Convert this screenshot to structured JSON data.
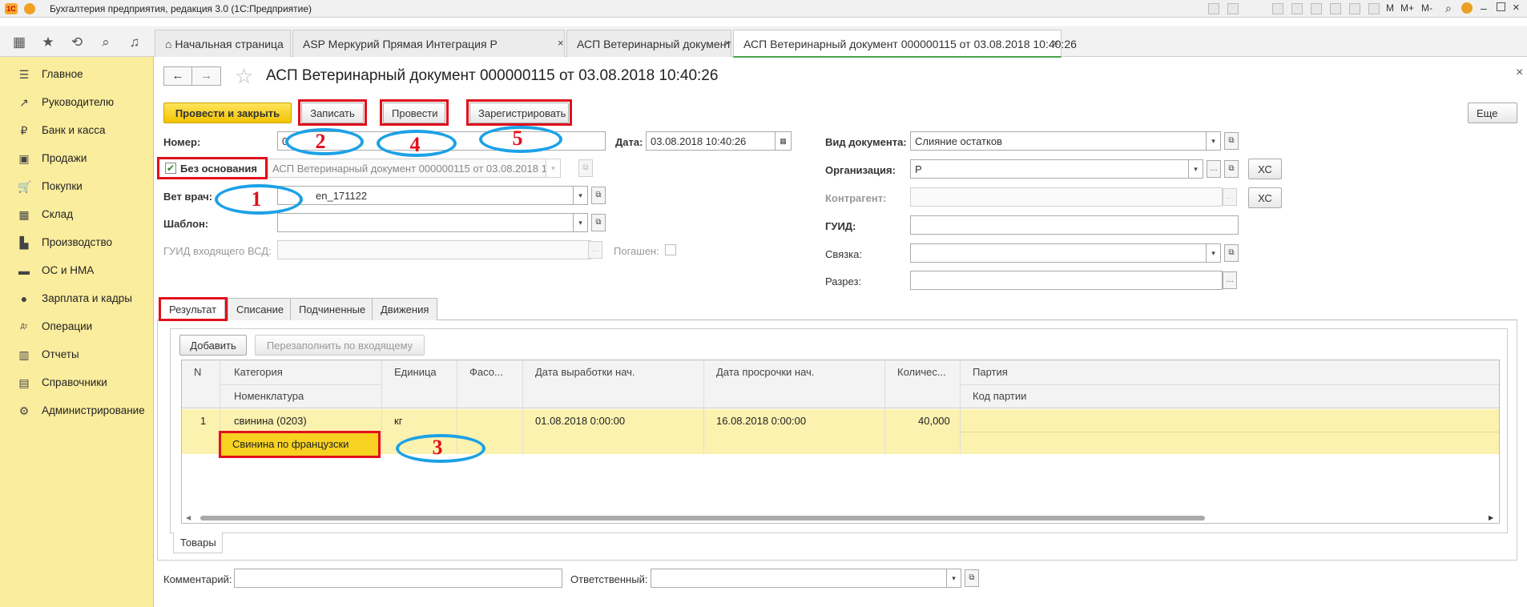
{
  "window": {
    "title": "Бухгалтерия предприятия, редакция 3.0  (1С:Предприятие)",
    "right_tools": [
      "M",
      "M+",
      "M-"
    ]
  },
  "tabs": [
    {
      "label": "Начальная страница",
      "closable": false
    },
    {
      "label": "ASP Меркурий Прямая Интеграция Р",
      "closable": true
    },
    {
      "label": "АСП Ветеринарный документ",
      "closable": true
    },
    {
      "label": "АСП Ветеринарный документ 000000115 от 03.08.2018 10:40:26",
      "closable": true
    }
  ],
  "close_glyph": "×",
  "sidebar": {
    "items": [
      {
        "label": "Главное",
        "icon": "menu-icon",
        "glyph": "☰"
      },
      {
        "label": "Руководителю",
        "icon": "trend-icon",
        "glyph": "↗"
      },
      {
        "label": "Банк и касса",
        "icon": "coin-icon",
        "glyph": "₽"
      },
      {
        "label": "Продажи",
        "icon": "bag-icon",
        "glyph": "▣"
      },
      {
        "label": "Покупки",
        "icon": "cart-icon",
        "glyph": "🛒"
      },
      {
        "label": "Склад",
        "icon": "grid-icon",
        "glyph": "▦"
      },
      {
        "label": "Производство",
        "icon": "factory-icon",
        "glyph": "▙"
      },
      {
        "label": "ОС и НМА",
        "icon": "truck-icon",
        "glyph": "▬"
      },
      {
        "label": "Зарплата и кадры",
        "icon": "person-icon",
        "glyph": "●"
      },
      {
        "label": "Операции",
        "icon": "operations-icon",
        "glyph": "Дт"
      },
      {
        "label": "Отчеты",
        "icon": "chart-icon",
        "glyph": "▥"
      },
      {
        "label": "Справочники",
        "icon": "book-icon",
        "glyph": "▤"
      },
      {
        "label": "Администрирование",
        "icon": "gear-icon",
        "glyph": "⚙"
      }
    ]
  },
  "doc": {
    "title": "АСП Ветеринарный документ 000000115 от 03.08.2018 10:40:26",
    "buttons": {
      "post_close": "Провести и закрыть",
      "save": "Записать",
      "post": "Провести",
      "register": "Зарегистрировать",
      "more": "Еще"
    },
    "fields": {
      "number_label": "Номер:",
      "number_value": "0",
      "date_label": "Дата:",
      "date_value": "03.08.2018 10:40:26",
      "no_basis_label": "Без основания",
      "basis_value": "АСП Ветеринарный документ 000000115 от 03.08.2018 10",
      "vet_label": "Вет врач:",
      "vet_value": "en_171122",
      "template_label": "Шаблон:",
      "template_value": "",
      "guid_in_label": "ГУИД входящего ВСД:",
      "guid_in_value": "",
      "paid_label": "Погашен:",
      "doctype_label": "Вид документа:",
      "doctype_value": "Слияние остатков",
      "org_label": "Организация:",
      "org_value": "Р",
      "contractor_label": "Контрагент:",
      "contractor_value": "",
      "guid_label": "ГУИД:",
      "guid_value": "",
      "link_label": "Связка:",
      "link_value": "",
      "section_label": "Разрез:",
      "section_value": "",
      "xc": "ХС"
    },
    "subtabs": [
      "Результат",
      "Списание",
      "Подчиненные",
      "Движения"
    ],
    "table_buttons": {
      "add": "Добавить",
      "refill": "Перезаполнить по входящему"
    },
    "table": {
      "headers_top": [
        "N",
        "Категория",
        "Единица",
        "Фасо...",
        "Дата выработки нач.",
        "Дата просрочки нач.",
        "Количес...",
        "Партия"
      ],
      "headers_bottom": [
        "Номенклатура",
        "Код партии"
      ],
      "rows": [
        {
          "n": "1",
          "category": "свинина (0203)",
          "nomenclature": "Свинина по французски",
          "unit": "кг",
          "packing": "",
          "prod_date": "01.08.2018 0:00:00",
          "exp_date": "16.08.2018 0:00:00",
          "qty": "40,000",
          "batch": "",
          "batch_code": ""
        }
      ]
    },
    "goods_tab": "Товары",
    "comment_label": "Комментарий:",
    "comment_value": "",
    "responsible_label": "Ответственный:",
    "responsible_value": ""
  },
  "annotations": {
    "marks": [
      "1",
      "2",
      "3",
      "4",
      "5"
    ],
    "color": "#e0101c",
    "ellipse_color": "#1da1e6"
  }
}
